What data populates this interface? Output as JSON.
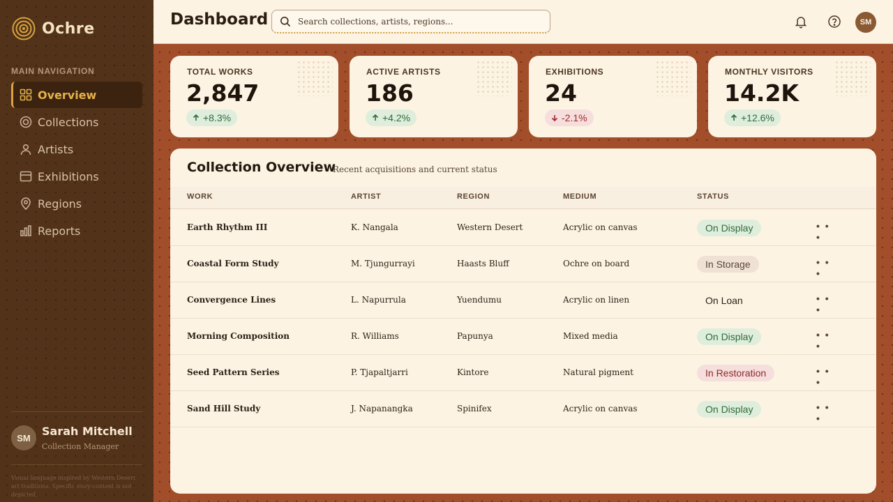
{
  "app": {
    "name": "Ochre",
    "brand_color": "#d9a441"
  },
  "sidebar": {
    "section_label": "MAIN NAVIGATION",
    "items": [
      {
        "label": "Overview",
        "icon": "grid-icon",
        "active": true
      },
      {
        "label": "Collections",
        "icon": "target-icon",
        "active": false
      },
      {
        "label": "Artists",
        "icon": "person-icon",
        "active": false
      },
      {
        "label": "Exhibitions",
        "icon": "frame-icon",
        "active": false
      },
      {
        "label": "Regions",
        "icon": "map-pin-icon",
        "active": false
      },
      {
        "label": "Reports",
        "icon": "bar-chart-icon",
        "active": false
      }
    ],
    "user": {
      "initials": "SM",
      "name": "Sarah Mitchell",
      "role": "Collection Manager"
    },
    "footnote": "Visual language inspired by Western Desert art traditions. Specific story-content is not depicted."
  },
  "header": {
    "title": "Dashboard",
    "search_placeholder": "Search collections, artists, regions...",
    "avatar_initials": "SM",
    "icons": [
      "bell-icon",
      "help-icon"
    ]
  },
  "stats": [
    {
      "label": "TOTAL WORKS",
      "value": "2,847",
      "delta": "+8.3%",
      "direction": "up"
    },
    {
      "label": "ACTIVE ARTISTS",
      "value": "186",
      "delta": "+4.2%",
      "direction": "up"
    },
    {
      "label": "EXHIBITIONS",
      "value": "24",
      "delta": "-2.1%",
      "direction": "down"
    },
    {
      "label": "MONTHLY VISITORS",
      "value": "14.2K",
      "delta": "+12.6%",
      "direction": "up"
    }
  ],
  "collection": {
    "title": "Collection Overview",
    "subtitle": "Recent acquisitions and current status",
    "columns": [
      "WORK",
      "ARTIST",
      "REGION",
      "MEDIUM",
      "STATUS"
    ],
    "rows": [
      {
        "work": "Earth Rhythm III",
        "artist": "K. Nangala",
        "region": "Western Desert",
        "medium": "Acrylic on canvas",
        "status": "On Display",
        "status_type": "display"
      },
      {
        "work": "Coastal Form Study",
        "artist": "M. Tjungurrayi",
        "region": "Haasts Bluff",
        "medium": "Ochre on board",
        "status": "In Storage",
        "status_type": "storage"
      },
      {
        "work": "Convergence Lines",
        "artist": "L. Napurrula",
        "region": "Yuendumu",
        "medium": "Acrylic on linen",
        "status": "On Loan",
        "status_type": "loan"
      },
      {
        "work": "Morning Composition",
        "artist": "R. Williams",
        "region": "Papunya",
        "medium": "Mixed media",
        "status": "On Display",
        "status_type": "display"
      },
      {
        "work": "Seed Pattern Series",
        "artist": "P. Tjapaltjarri",
        "region": "Kintore",
        "medium": "Natural pigment",
        "status": "In Restoration",
        "status_type": "restoration"
      },
      {
        "work": "Sand Hill Study",
        "artist": "J. Napanangka",
        "region": "Spinifex",
        "medium": "Acrylic on canvas",
        "status": "On Display",
        "status_type": "display"
      }
    ],
    "row_menu_label": "• • •"
  }
}
